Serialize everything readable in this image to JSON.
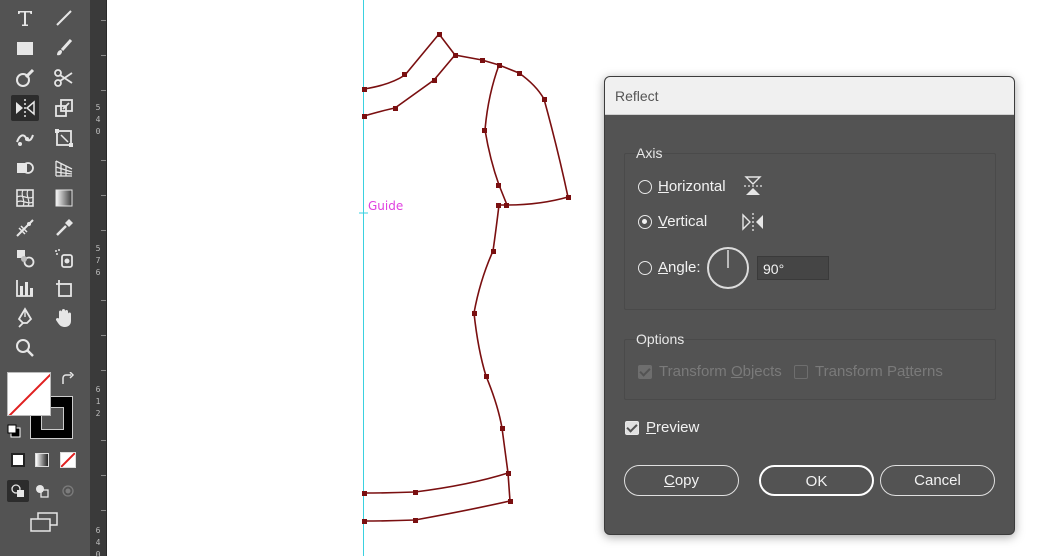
{
  "ruler": {
    "digits": [
      "5",
      "4",
      "0",
      "5",
      "7",
      "6",
      "6",
      "1",
      "2",
      "6",
      "4",
      "0"
    ]
  },
  "canvas": {
    "guide_label": "Guide"
  },
  "dialog": {
    "title": "Reflect",
    "axis": {
      "legend": "Axis",
      "horizontal": {
        "pre": "",
        "u": "H",
        "post": "orizontal"
      },
      "vertical": {
        "pre": "",
        "u": "V",
        "post": "ertical"
      },
      "angle": {
        "pre": "",
        "u": "A",
        "post": "ngle:"
      },
      "angle_value": "90°",
      "selected": "vertical"
    },
    "options": {
      "legend": "Options",
      "transform_objects": {
        "pre": "Transform ",
        "u": "O",
        "post": "bjects",
        "checked": true,
        "disabled": true
      },
      "transform_patterns": {
        "pre": "Transform Pa",
        "u": "t",
        "post": "terns",
        "checked": false,
        "disabled": true
      }
    },
    "preview": {
      "pre": "",
      "u": "P",
      "post": "review",
      "checked": true
    },
    "buttons": {
      "copy": {
        "pre": "",
        "u": "C",
        "post": "opy"
      },
      "ok": "OK",
      "cancel": "Cancel"
    }
  },
  "colors": {
    "path": "#7a0f10",
    "guide": "#3ad1e0",
    "guide_label": "#e040e0",
    "dialog_bg": "#535353"
  }
}
